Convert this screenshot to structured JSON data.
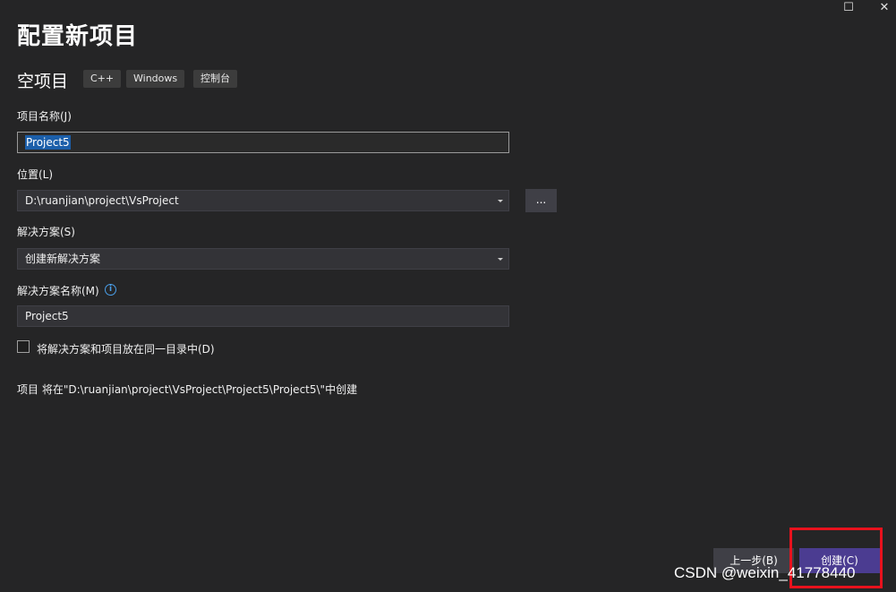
{
  "window": {
    "maximize_icon": "maximize-icon",
    "close_icon": "close-icon",
    "maximize_glyph": "☐",
    "close_glyph": "✕"
  },
  "header": {
    "title": "配置新项目",
    "template_name": "空项目",
    "tags": [
      "C++",
      "Windows",
      "控制台"
    ]
  },
  "form": {
    "project_name_label": "项目名称(J)",
    "project_name_value": "Project5",
    "location_label": "位置(L)",
    "location_value": "D:\\ruanjian\\project\\VsProject",
    "browse_label": "...",
    "solution_label": "解决方案(S)",
    "solution_value": "创建新解决方案",
    "solution_name_label": "解决方案名称(M)",
    "solution_name_value": "Project5",
    "same_dir_label": "将解决方案和项目放在同一目录中(D)",
    "same_dir_checked": false,
    "summary": "项目 将在\"D:\\ruanjian\\project\\VsProject\\Project5\\Project5\\\"中创建"
  },
  "footer": {
    "back_label": "上一步(B)",
    "create_label": "创建(C)"
  },
  "watermark": "CSDN @weixin_41778440",
  "colors": {
    "background": "#252526",
    "accent": "#4b3c91",
    "selection": "#1c5faa",
    "highlight": "#e8121d",
    "info": "#4a9ee8"
  }
}
